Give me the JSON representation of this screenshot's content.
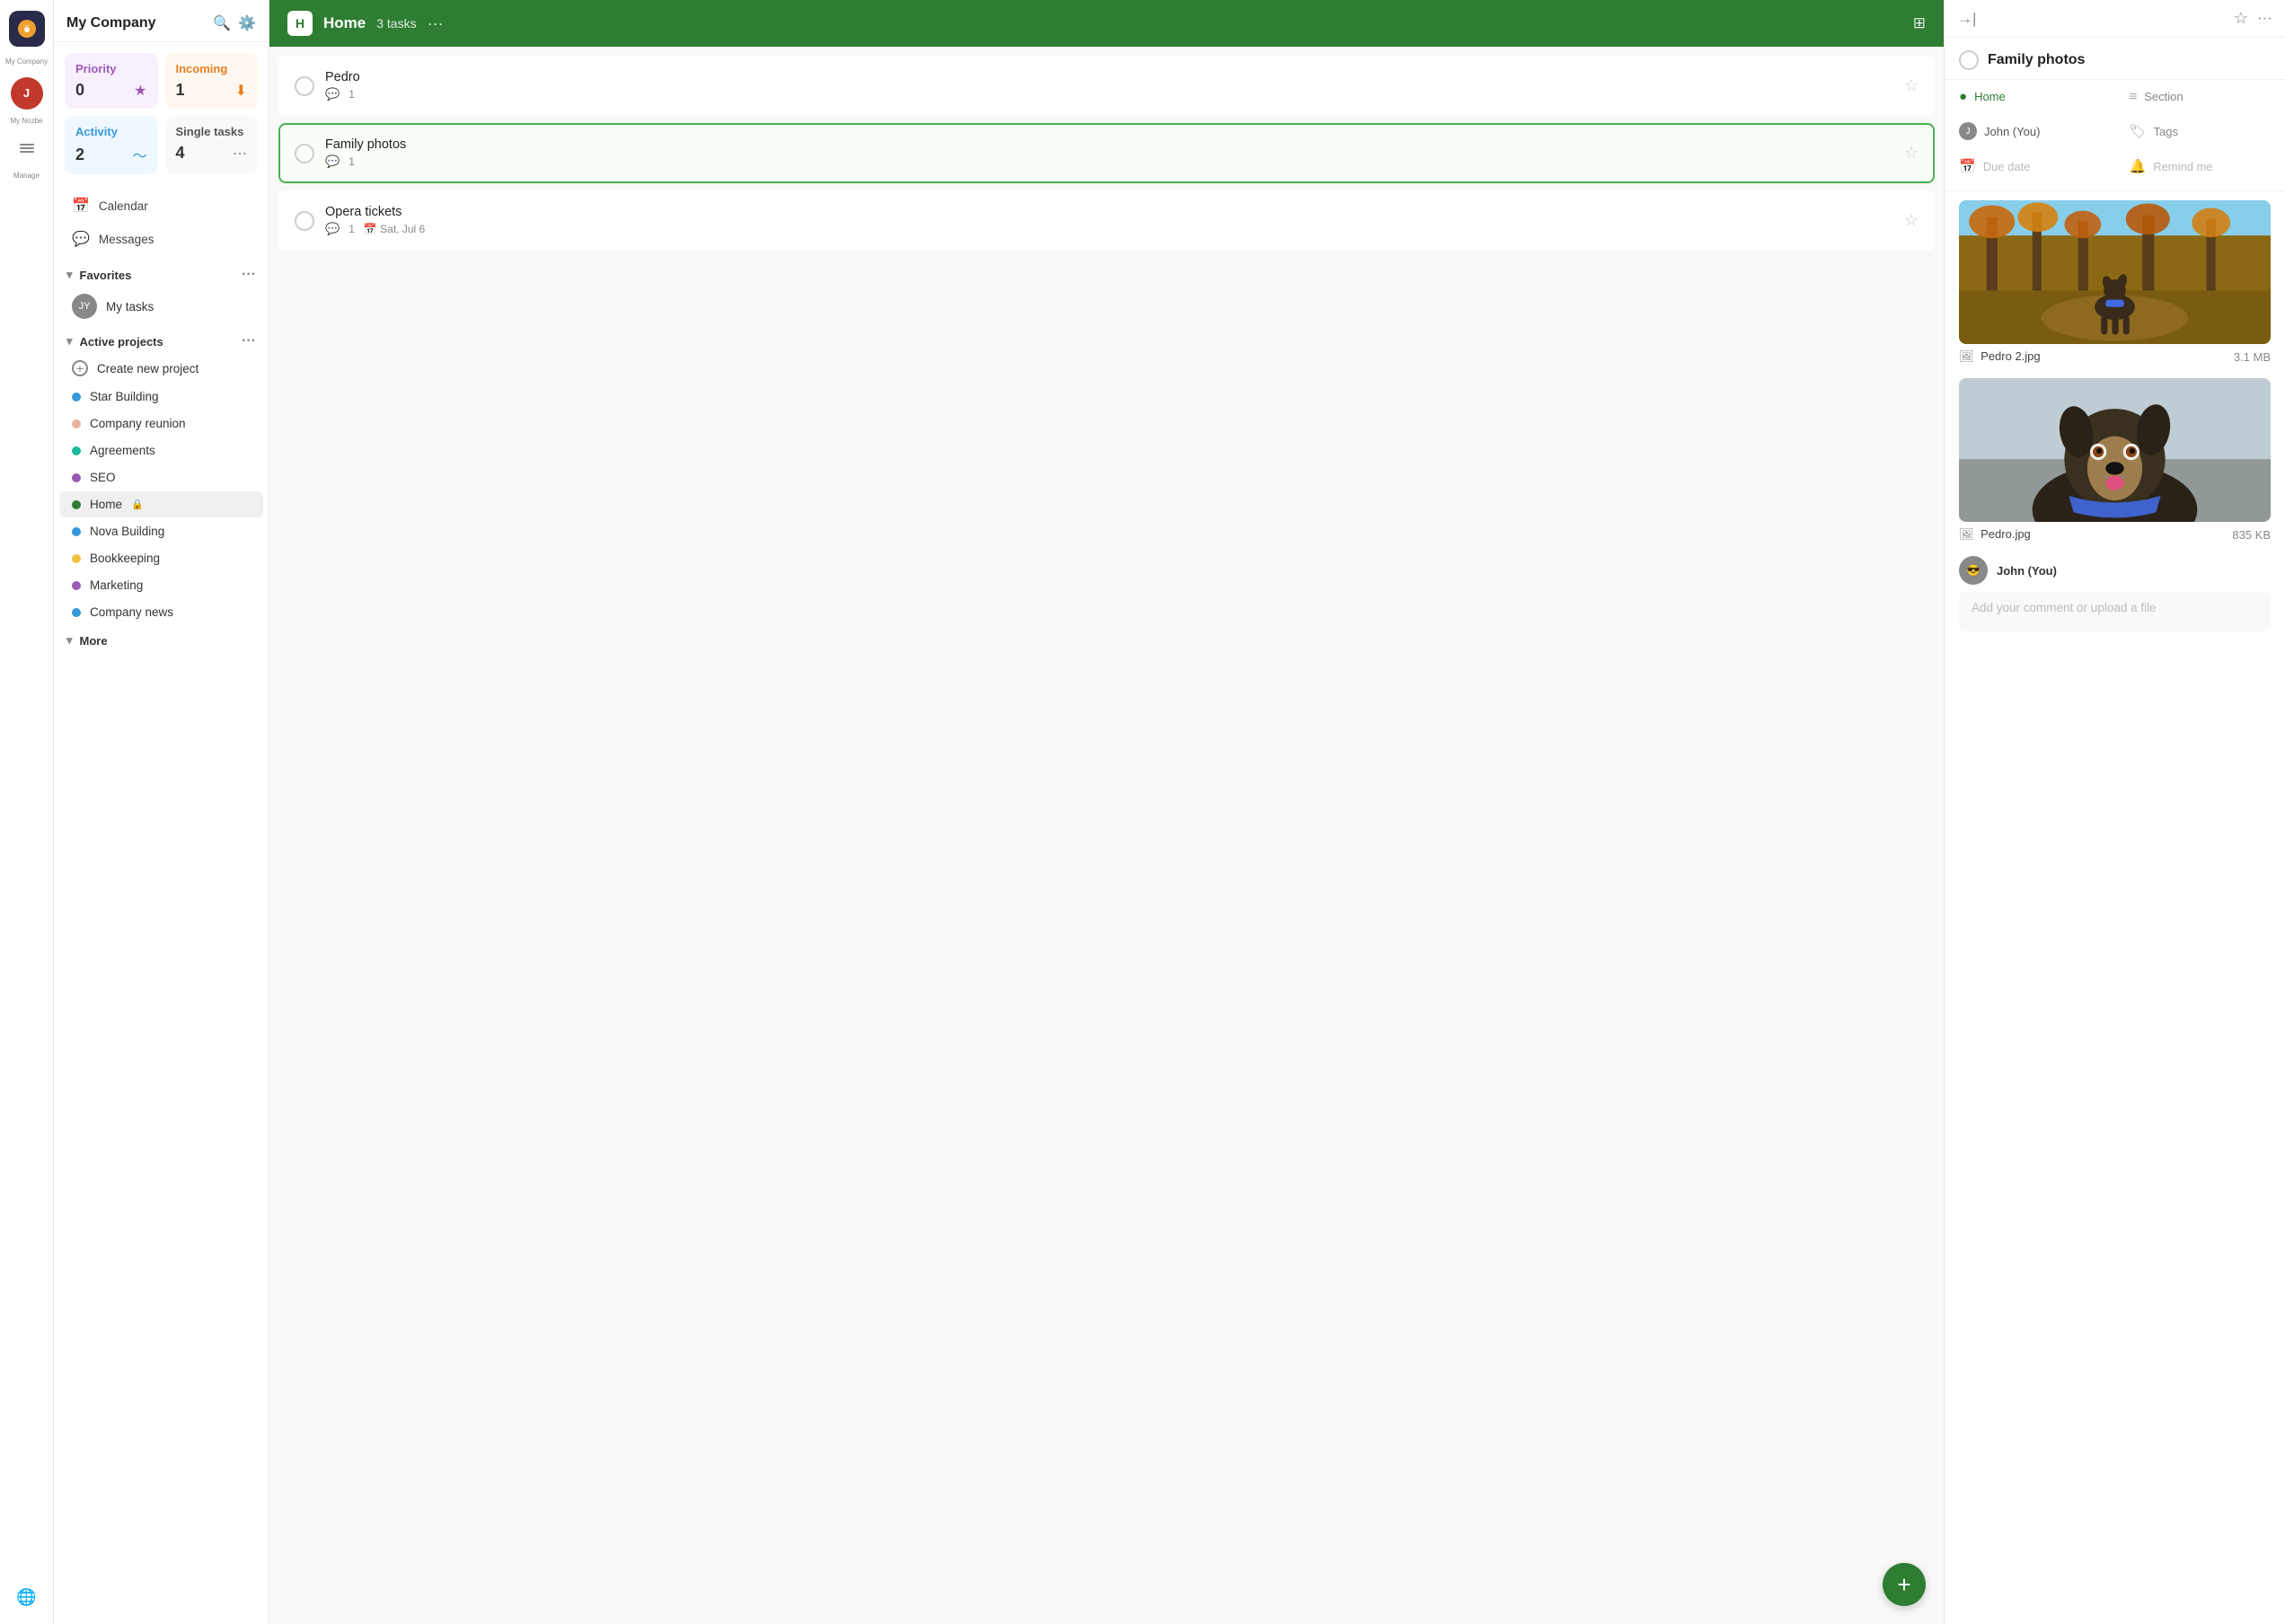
{
  "app": {
    "name": "My Company",
    "user_label": "My Nozbe",
    "manage_label": "Manage"
  },
  "sidebar": {
    "company_name": "My Company",
    "cards": {
      "priority": {
        "label": "Priority",
        "count": "0"
      },
      "incoming": {
        "label": "Incoming",
        "count": "1"
      },
      "activity": {
        "label": "Activity",
        "count": "2"
      },
      "single": {
        "label": "Single tasks",
        "count": "4"
      }
    },
    "nav_items": [
      {
        "id": "calendar",
        "label": "Calendar",
        "icon": "📅"
      },
      {
        "id": "messages",
        "label": "Messages",
        "icon": "💬"
      }
    ],
    "favorites_label": "Favorites",
    "my_tasks_label": "My tasks",
    "active_projects_label": "Active projects",
    "create_project_label": "Create new project",
    "projects": [
      {
        "id": "star-building",
        "label": "Star Building",
        "color": "#3498db"
      },
      {
        "id": "company-reunion",
        "label": "Company reunion",
        "color": "#e8b4a0"
      },
      {
        "id": "agreements",
        "label": "Agreements",
        "color": "#1abc9c"
      },
      {
        "id": "seo",
        "label": "SEO",
        "color": "#9b59b6"
      },
      {
        "id": "home",
        "label": "Home",
        "color": "#2e7d32",
        "active": true,
        "locked": true
      },
      {
        "id": "nova-building",
        "label": "Nova Building",
        "color": "#3498db"
      },
      {
        "id": "bookkeeping",
        "label": "Bookkeeping",
        "color": "#f0c040"
      },
      {
        "id": "marketing",
        "label": "Marketing",
        "color": "#9b59b6"
      },
      {
        "id": "company-news",
        "label": "Company news",
        "color": "#3498db"
      }
    ],
    "more_label": "More"
  },
  "main": {
    "project_title": "Home",
    "task_count": "3 tasks",
    "more_options": "···",
    "tasks": [
      {
        "id": "pedro",
        "name": "Pedro",
        "comments": 1,
        "date": null,
        "selected": false
      },
      {
        "id": "family-photos",
        "name": "Family photos",
        "comments": 1,
        "date": null,
        "selected": true
      },
      {
        "id": "opera-tickets",
        "name": "Opera tickets",
        "comments": 1,
        "date": "Sat, Jul 6",
        "selected": false
      }
    ],
    "fab_label": "+"
  },
  "right_panel": {
    "task_title": "Family photos",
    "meta": {
      "project_label": "Home",
      "section_label": "Section",
      "assignee_label": "John (You)",
      "tags_label": "Tags",
      "due_date_label": "Due date",
      "remind_me_label": "Remind me"
    },
    "attachments": [
      {
        "id": "pedro2",
        "filename": "Pedro 2.jpg",
        "size": "3.1 MB"
      },
      {
        "id": "pedro",
        "filename": "Pedro.jpg",
        "size": "835 KB"
      }
    ],
    "commenter": {
      "name": "John (You)"
    },
    "comment_placeholder": "Add your comment or upload a file"
  }
}
